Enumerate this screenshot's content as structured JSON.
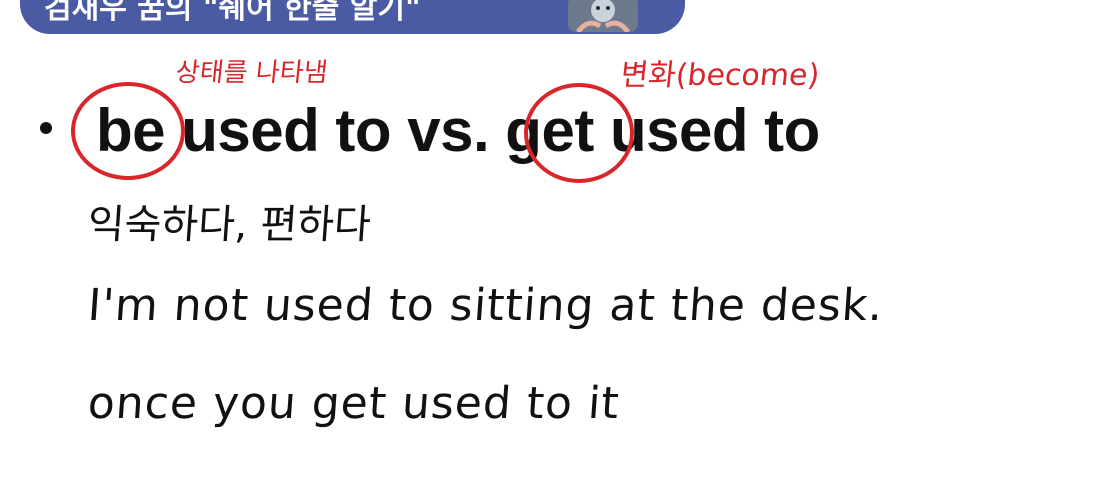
{
  "header": {
    "title": "검새우 꿈의 \"쉐어 한줄 알기\""
  },
  "annotations": {
    "be_note": "상태를 나타냄",
    "get_note": "변화(become)"
  },
  "main": {
    "word_be": "be",
    "text_used_to_vs": "used to vs.",
    "word_get": "get",
    "text_used_to": "used to"
  },
  "notes": {
    "meaning": "익숙하다, 편하다",
    "example_1": "I'm not used to sitting at the desk.",
    "example_2": "once you get used to it"
  },
  "colors": {
    "banner": "#4a5aa3",
    "annotation_red": "#d8262a",
    "text": "#111111"
  }
}
